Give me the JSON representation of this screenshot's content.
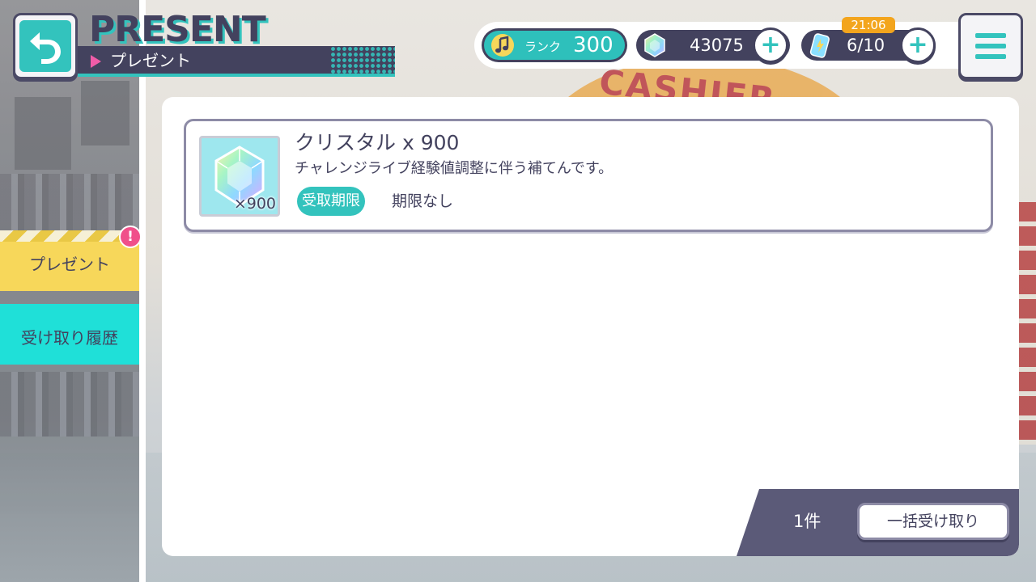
{
  "header": {
    "title_en": "PRESENT",
    "title_jp": "プレゼント",
    "back_icon": "back-arrow-icon",
    "menu_icon": "hamburger-menu-icon"
  },
  "status": {
    "rank_label": "ランク",
    "rank_value": "300",
    "crystal_value": "43075",
    "energy_value": "6/10",
    "energy_timer": "21:06",
    "plus_symbol": "+"
  },
  "tabs": [
    {
      "label": "プレゼント",
      "active": true,
      "alert": "!"
    },
    {
      "label": "受け取り履歴",
      "active": false
    }
  ],
  "presents": [
    {
      "icon": "crystal-icon",
      "quantity_label": "×900",
      "title": "クリスタル x 900",
      "description": "チャレンジライブ経験値調整に伴う補てんです。",
      "deadline_label": "受取期限",
      "deadline_value": "期限なし"
    }
  ],
  "footer": {
    "count": "1件",
    "receive_all_label": "一括受け取り"
  },
  "background": {
    "sign_text": "CASHIER"
  },
  "colors": {
    "accent": "#33c3bd",
    "navy": "#43425e",
    "tab_active": "#f7d75a",
    "tab_inactive": "#1fe0d8",
    "alert": "#f0508a",
    "timer": "#f3a51d"
  }
}
